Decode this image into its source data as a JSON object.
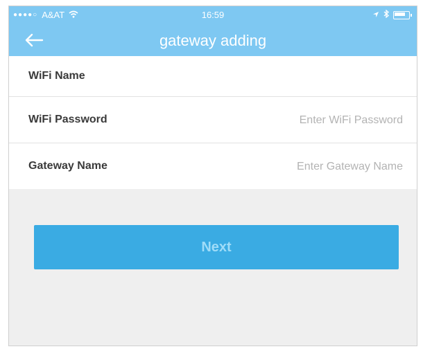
{
  "status_bar": {
    "signal_dots": "●●●●○",
    "carrier": "A&AT",
    "time": "16:59"
  },
  "nav": {
    "title": "gateway adding"
  },
  "form": {
    "wifi_name": {
      "label": "WiFi Name",
      "value": "",
      "placeholder": ""
    },
    "wifi_password": {
      "label": "WiFi Password",
      "value": "",
      "placeholder": "Enter WiFi Password"
    },
    "gateway_name": {
      "label": "Gateway Name",
      "value": "",
      "placeholder": "Enter Gateway Name"
    }
  },
  "next_button": {
    "label": "Next"
  },
  "colors": {
    "header_bg": "#7ec8f2",
    "button_bg": "#3aabe3",
    "screen_bg": "#efefef"
  },
  "icons": [
    "wifi-icon",
    "location-icon",
    "bluetooth-icon",
    "battery-icon",
    "back-arrow-icon"
  ]
}
